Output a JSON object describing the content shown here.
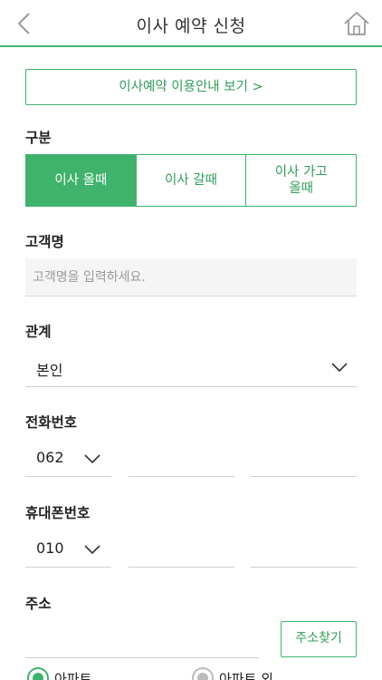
{
  "header": {
    "title": "이사 예약 신청",
    "back_icon": "chevron-left-icon",
    "home_icon": "home-icon"
  },
  "guide_button": {
    "label": "이사예약 이용안내 보기 >"
  },
  "category": {
    "label": "구분",
    "options": [
      {
        "label": "이사 올때",
        "selected": true
      },
      {
        "label": "이사 갈때",
        "selected": false
      },
      {
        "label_line1": "이사 가고",
        "label_line2": "올때",
        "selected": false
      }
    ]
  },
  "customer_name": {
    "label": "고객명",
    "placeholder": "고객명을 입력하세요."
  },
  "relation": {
    "label": "관계",
    "value": "본인"
  },
  "phone": {
    "label": "전화번호",
    "area_code": "062"
  },
  "mobile": {
    "label": "휴대폰번호",
    "prefix": "010"
  },
  "address": {
    "label": "주소",
    "search_button": "주소찾기",
    "radio_options": [
      {
        "label": "아파트",
        "selected": true
      },
      {
        "label": "아파트 외",
        "selected": false
      }
    ]
  },
  "colors": {
    "accent": "#3fb36b",
    "accent_text": "#2f9e58"
  }
}
